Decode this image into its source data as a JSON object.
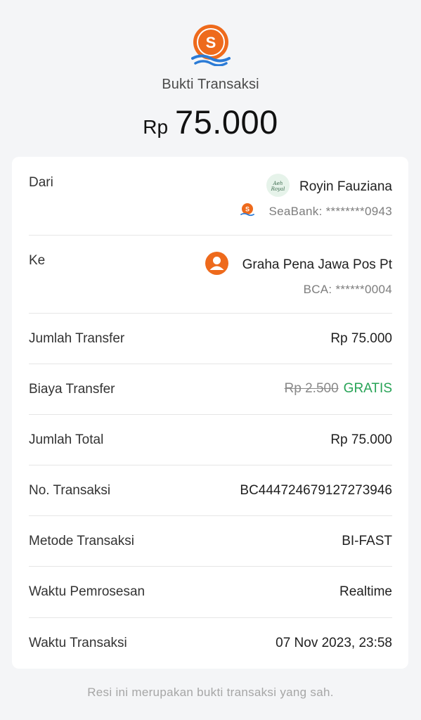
{
  "header": {
    "logo_icon": "seabank-logo-icon",
    "title": "Bukti Transaksi",
    "amount_currency": "Rp",
    "amount_value": "75.000"
  },
  "colors": {
    "brand_orange": "#ee6a1c",
    "brand_blue": "#2b7bd6",
    "gratis_green": "#27a356"
  },
  "details": {
    "from": {
      "label": "Dari",
      "name": "Royin Fauziana",
      "avatar_text": "Aeh Royal",
      "bank_icon": "seabank-logo-icon",
      "account": "SeaBank: ********0943"
    },
    "to": {
      "label": "Ke",
      "name": "Graha Pena Jawa Pos Pt",
      "avatar_icon": "person-icon",
      "account": "BCA: ******0004"
    },
    "transfer_amount": {
      "label": "Jumlah Transfer",
      "value": "Rp 75.000"
    },
    "transfer_fee": {
      "label": "Biaya Transfer",
      "original": "Rp 2.500",
      "value": "GRATIS"
    },
    "total_amount": {
      "label": "Jumlah Total",
      "value": "Rp 75.000"
    },
    "transaction_no": {
      "label": "No. Transaksi",
      "value": "BC444724679127273946"
    },
    "method": {
      "label": "Metode Transaksi",
      "value": "BI-FAST"
    },
    "processing_time": {
      "label": "Waktu Pemrosesan",
      "value": "Realtime"
    },
    "transaction_time": {
      "label": "Waktu Transaksi",
      "value": "07 Nov 2023, 23:58"
    }
  },
  "footer": {
    "note": "Resi ini merupakan bukti transaksi yang sah."
  }
}
